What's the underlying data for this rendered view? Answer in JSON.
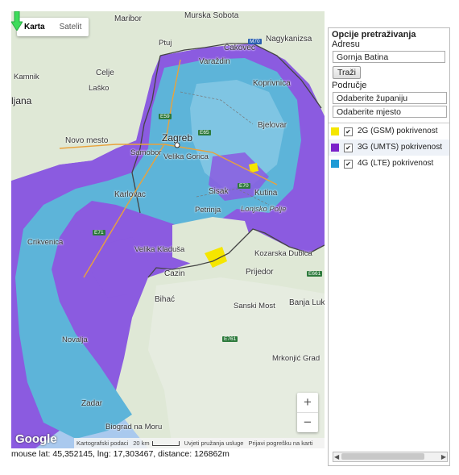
{
  "map": {
    "maptype": {
      "active": "Karta",
      "inactive": "Satelit"
    },
    "places": [
      {
        "id": "maribor",
        "name": "Maribor",
        "cls": "med"
      },
      {
        "id": "murska",
        "name": "Murska Sobota",
        "cls": "med"
      },
      {
        "id": "ptuj",
        "name": "Ptuj",
        "cls": ""
      },
      {
        "id": "cakovec",
        "name": "Čakovec",
        "cls": "med"
      },
      {
        "id": "nagykanizsa",
        "name": "Nagykanizsa",
        "cls": "med"
      },
      {
        "id": "celje",
        "name": "Celje",
        "cls": "med"
      },
      {
        "id": "kamnik",
        "name": "Kamnik",
        "cls": ""
      },
      {
        "id": "lasko",
        "name": "Laško",
        "cls": ""
      },
      {
        "id": "varazdin",
        "name": "Varaždin",
        "cls": "med"
      },
      {
        "id": "koprivnica",
        "name": "Koprivnica",
        "cls": "med"
      },
      {
        "id": "ljubljana",
        "name": "ljana",
        "cls": "big"
      },
      {
        "id": "novomesto",
        "name": "Novo mesto",
        "cls": "med"
      },
      {
        "id": "bjelovar",
        "name": "Bjelovar",
        "cls": "med"
      },
      {
        "id": "zagreb",
        "name": "Zagreb",
        "cls": "big"
      },
      {
        "id": "samobor",
        "name": "Samobor",
        "cls": ""
      },
      {
        "id": "velikagorica",
        "name": "Velika Gorica",
        "cls": ""
      },
      {
        "id": "karlovac",
        "name": "Karlovac",
        "cls": "med"
      },
      {
        "id": "sisak",
        "name": "Sisak",
        "cls": "med"
      },
      {
        "id": "kutina",
        "name": "Kutina",
        "cls": "med"
      },
      {
        "id": "petrinja",
        "name": "Petrinja",
        "cls": ""
      },
      {
        "id": "lonjsko",
        "name": "Lonjsko Polje",
        "cls": "region"
      },
      {
        "id": "crikvenica",
        "name": "Crikvenica",
        "cls": ""
      },
      {
        "id": "velikakladusa",
        "name": "Velika Kladuša",
        "cls": ""
      },
      {
        "id": "kozarska",
        "name": "Kozarska Dubica",
        "cls": ""
      },
      {
        "id": "cazin",
        "name": "Cazin",
        "cls": "med"
      },
      {
        "id": "prijedor",
        "name": "Prijedor",
        "cls": "med"
      },
      {
        "id": "bihac",
        "name": "Bihać",
        "cls": "med"
      },
      {
        "id": "sanskimost",
        "name": "Sanski Most",
        "cls": ""
      },
      {
        "id": "banjaluka",
        "name": "Banja Luk",
        "cls": "med"
      },
      {
        "id": "novalja",
        "name": "Novalja",
        "cls": ""
      },
      {
        "id": "mrkonjic",
        "name": "Mrkonjić Grad",
        "cls": ""
      },
      {
        "id": "zadar",
        "name": "Zadar",
        "cls": "med"
      },
      {
        "id": "biograd",
        "name": "Biograd na Moru",
        "cls": ""
      }
    ],
    "roads": [
      {
        "id": "m70",
        "label": "M70",
        "blue": true
      },
      {
        "id": "e59",
        "label": "E59",
        "blue": false
      },
      {
        "id": "e65",
        "label": "E65",
        "blue": false
      },
      {
        "id": "e70",
        "label": "E70",
        "blue": false
      },
      {
        "id": "e71",
        "label": "E71",
        "blue": false
      },
      {
        "id": "e661",
        "label": "E661",
        "blue": false
      },
      {
        "id": "e761",
        "label": "E761",
        "blue": false
      }
    ],
    "zoom": {
      "in": "+",
      "out": "−"
    },
    "logo": "Google",
    "attribution": {
      "data": "Kartografski podaci",
      "scale": "20 km",
      "terms": "Uvjeti pružanja usluge",
      "report": "Prijavi pogrešku na karti"
    },
    "colors": {
      "umts": "#8b5be0",
      "lte": "#5db4d9",
      "land": "#dfe8d6",
      "border": "#444444",
      "marker": "#3ddc5a"
    }
  },
  "readout": "mouse lat: 45,352145, lng: 17,303467, distance: 126862m",
  "panel": {
    "title": "Opcije pretraživanja",
    "address_label": "Adresu",
    "address_value": "Gornja Batina",
    "search_button": "Traži",
    "area_label": "Područje",
    "county_select": "Odaberite županiju",
    "place_select": "Odaberite mjesto",
    "legend": [
      {
        "color": "#f5e600",
        "label": "2G (GSM) pokrivenost",
        "checked": true
      },
      {
        "color": "#7b22c9",
        "label": "3G (UMTS) pokrivenost",
        "checked": true
      },
      {
        "color": "#1f9bd6",
        "label": "4G (LTE) pokrivenost",
        "checked": true
      }
    ],
    "scroll_left": "◀",
    "scroll_right": "▶"
  }
}
